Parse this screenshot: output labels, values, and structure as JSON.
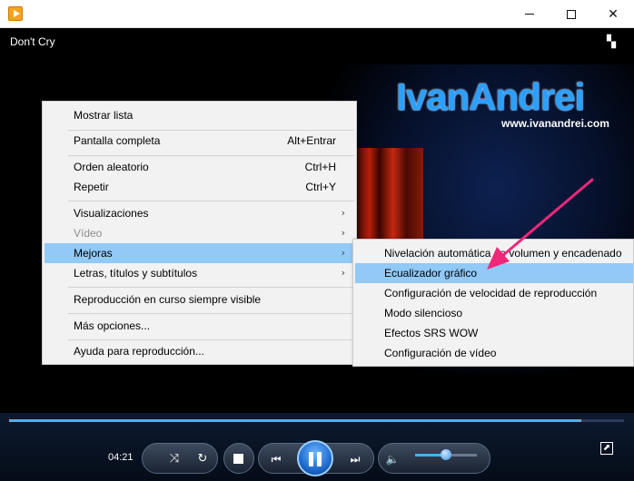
{
  "window": {
    "title": "Don't Cry",
    "minimize_glyph": "",
    "close_glyph": "✕"
  },
  "video": {
    "logo_text": "IvanAndrei",
    "logo_url": "www.ivanandrei.com"
  },
  "menu": {
    "items": [
      {
        "label": "Mostrar lista",
        "shortcut": ""
      },
      {
        "label": "Pantalla completa",
        "shortcut": "Alt+Entrar"
      },
      {
        "label": "Orden aleatorio",
        "shortcut": "Ctrl+H"
      },
      {
        "label": "Repetir",
        "shortcut": "Ctrl+Y"
      },
      {
        "label": "Visualizaciones",
        "shortcut": ""
      },
      {
        "label": "Vídeo",
        "shortcut": ""
      },
      {
        "label": "Mejoras",
        "shortcut": ""
      },
      {
        "label": "Letras, títulos y subtítulos",
        "shortcut": ""
      },
      {
        "label": "Reproducción en curso siempre visible",
        "shortcut": ""
      },
      {
        "label": "Más opciones...",
        "shortcut": ""
      },
      {
        "label": "Ayuda para reproducción...",
        "shortcut": ""
      }
    ]
  },
  "submenu": {
    "items": [
      {
        "label": "Nivelación automática de volumen y encadenado"
      },
      {
        "label": "Ecualizador gráfico"
      },
      {
        "label": "Configuración de velocidad de reproducción"
      },
      {
        "label": "Modo silencioso"
      },
      {
        "label": "Efectos SRS WOW"
      },
      {
        "label": "Configuración de vídeo"
      }
    ]
  },
  "player": {
    "time": "04:21",
    "seek_progress": 0.93,
    "volume": 0.5
  },
  "colors": {
    "accent": "#4ab0ff",
    "menu_highlight": "#91c9f7",
    "annotation_arrow": "#f0287a"
  }
}
